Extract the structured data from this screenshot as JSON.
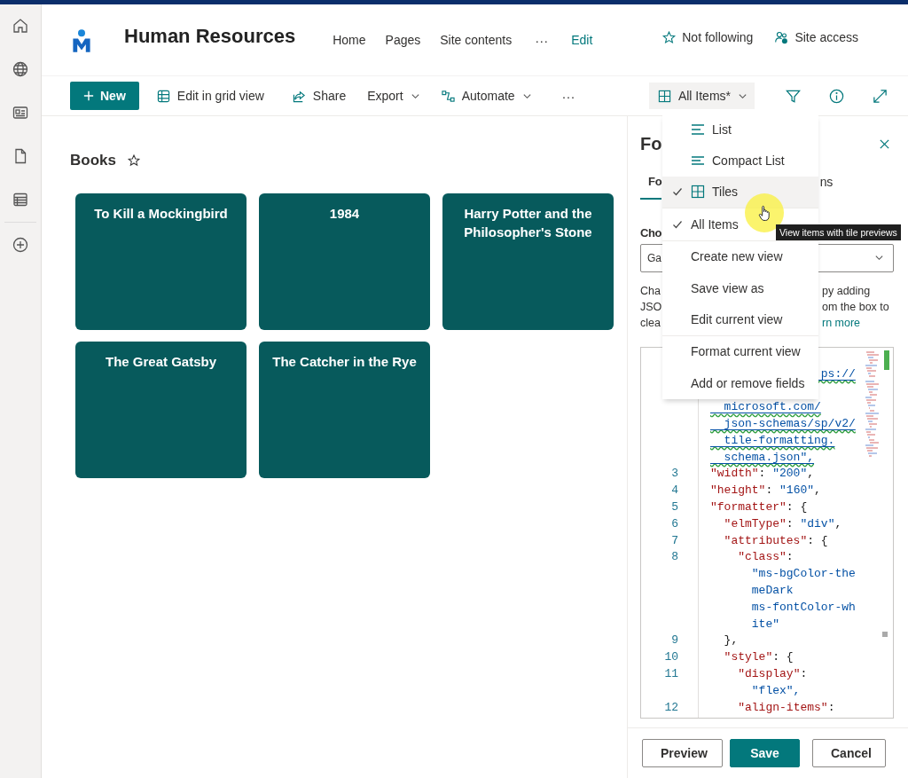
{
  "site": {
    "title": "Human Resources",
    "nav": [
      {
        "label": "Home",
        "kind": "link"
      },
      {
        "label": "Pages",
        "kind": "link"
      },
      {
        "label": "Site contents",
        "kind": "link"
      },
      {
        "label": "···",
        "kind": "more"
      },
      {
        "label": "Edit",
        "kind": "edit"
      }
    ],
    "follow": "Not following",
    "access": "Site access"
  },
  "command_bar": {
    "new": "New",
    "actions": [
      {
        "label": "Edit in grid view",
        "dropdown": false
      },
      {
        "label": "Share",
        "dropdown": false
      },
      {
        "label": "Export",
        "dropdown": true
      },
      {
        "label": "Automate",
        "dropdown": true
      }
    ],
    "more": "···",
    "view": {
      "label": "All Items*",
      "expanded": true
    }
  },
  "list": {
    "title": "Books",
    "favorite": false,
    "tiles": [
      {
        "title": "To Kill a Mockingbird"
      },
      {
        "title": "1984"
      },
      {
        "title": "Harry Potter and the Philosopher's Stone"
      },
      {
        "title": "The Great Gatsby"
      },
      {
        "title": "The Catcher in the Rye"
      }
    ]
  },
  "panel": {
    "title": "Fo",
    "tabs": [
      {
        "label": "Fo",
        "selected": true
      },
      {
        "label": "ns",
        "selected": false
      }
    ],
    "choose_label": "Cho",
    "dropdown_value": "Ga",
    "description": [
      {
        "left": "Cha",
        "right": "py adding",
        "kind": "text"
      },
      {
        "left": "JSO",
        "right": "om the box to",
        "kind": "text"
      },
      {
        "left": "clea",
        "right": "rn more",
        "kind": "link"
      }
    ],
    "code": [
      {
        "kind": "blank"
      },
      {
        "text": "                ps://",
        "kind": "wrap",
        "warning": true
      },
      {
        "kind": "blank"
      },
      {
        "text": "  microsoft.com/",
        "kind": "wrap",
        "warning": true
      },
      {
        "text": "  json-schemas/sp/v2/",
        "kind": "wrap",
        "warning": true
      },
      {
        "text": "  tile-formatting.",
        "kind": "wrap",
        "warning": true
      },
      {
        "text": "  schema.json\",",
        "kind": "wrap",
        "warning": true
      },
      {
        "number": "3",
        "text": "\"width\": \"200\",",
        "kind": "code",
        "warning": false
      },
      {
        "number": "4",
        "text": "\"height\": \"160\",",
        "kind": "code",
        "warning": false
      },
      {
        "number": "5",
        "text": "\"formatter\": {",
        "kind": "code",
        "warning": false
      },
      {
        "number": "6",
        "text": "  \"elmType\": \"div\",",
        "kind": "code",
        "warning": false
      },
      {
        "number": "7",
        "text": "  \"attributes\": {",
        "kind": "code",
        "warning": false
      },
      {
        "number": "8",
        "text": "    \"class\":",
        "kind": "code",
        "warning": false
      },
      {
        "text": "      \"ms-bgColor-the",
        "kind": "wrap",
        "warning": false
      },
      {
        "text": "      meDark",
        "kind": "wrap",
        "warning": false
      },
      {
        "text": "      ms-fontColor-wh",
        "kind": "wrap",
        "warning": false
      },
      {
        "text": "      ite\"",
        "kind": "wrap",
        "warning": false
      },
      {
        "number": "9",
        "text": "  },",
        "kind": "code",
        "warning": false
      },
      {
        "number": "10",
        "text": "  \"style\": {",
        "kind": "code",
        "warning": false
      },
      {
        "number": "11",
        "text": "    \"display\":",
        "kind": "code",
        "warning": false
      },
      {
        "text": "      \"flex\",",
        "kind": "wrap",
        "warning": false
      },
      {
        "number": "12",
        "text": "    \"align-items\":",
        "kind": "code",
        "warning": false
      }
    ],
    "buttons": [
      {
        "label": "Preview",
        "kind": "secondary"
      },
      {
        "label": "Save",
        "kind": "primary"
      },
      {
        "label": "Cancel",
        "kind": "secondary"
      }
    ]
  },
  "view_menu": {
    "sections": [
      {
        "items": [
          {
            "label": "List",
            "kind": "layout",
            "checked": false,
            "selected": false
          },
          {
            "label": "Compact List",
            "kind": "layout",
            "checked": false,
            "selected": false
          },
          {
            "label": "Tiles",
            "kind": "layout",
            "checked": true,
            "selected": true
          }
        ]
      },
      {
        "items": [
          {
            "label": "All Items",
            "kind": "view",
            "checked": true,
            "selected": false
          }
        ]
      },
      {
        "items": [
          {
            "label": "Create new view",
            "kind": "action",
            "checked": false,
            "selected": false
          },
          {
            "label": "Save view as",
            "kind": "action",
            "checked": false,
            "selected": false
          },
          {
            "label": "Edit current view",
            "kind": "action",
            "checked": false,
            "selected": false
          }
        ]
      },
      {
        "items": [
          {
            "label": "Format current view",
            "kind": "action",
            "checked": false,
            "selected": false
          },
          {
            "label": "Add or remove fields",
            "kind": "action",
            "checked": false,
            "selected": false
          }
        ]
      }
    ]
  },
  "tooltip": "View items with tile previews"
}
